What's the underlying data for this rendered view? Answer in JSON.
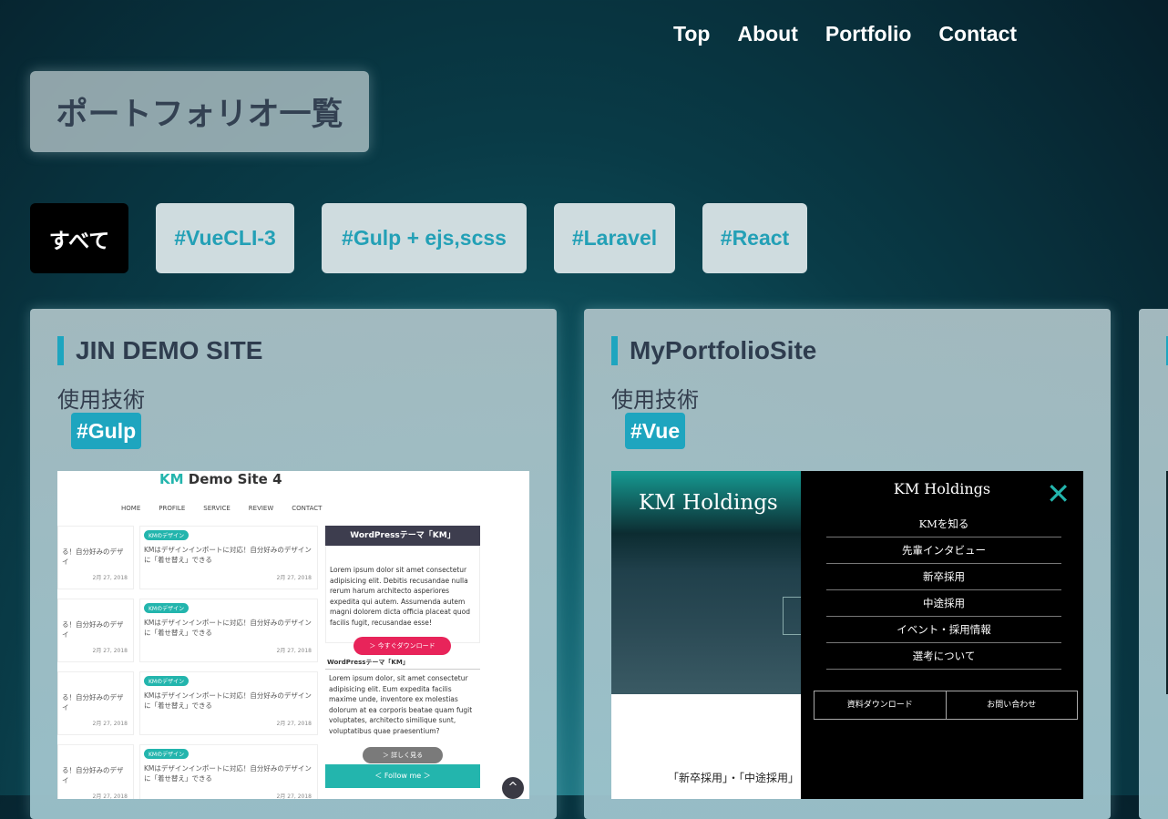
{
  "nav": [
    "Top",
    "About",
    "Portfolio",
    "Contact"
  ],
  "page_title": "ポートフォリオ一覧",
  "filters": [
    "すべて",
    "#VueCLI-3",
    "#Gulp + ejs,scss",
    "#Laravel",
    "#React"
  ],
  "tech_label": "使用技術",
  "cards": [
    {
      "title": "JIN DEMO SITE",
      "tag": "#Gulp",
      "preview": {
        "logo_accent": "KM",
        "logo_rest": " Demo Site 4",
        "menu": [
          "HOME",
          "PROFILE",
          "SERVICE",
          "REVIEW",
          "CONTACT"
        ],
        "post_badge": "KMのデザイン",
        "post_text": "KMはデザインインポートに対応！自分好みのデザインに「着せ替え」できる",
        "post_left_text": "る！自分好みのデザイ",
        "post_date": "2月 27, 2018",
        "side_head": "WordPressテーマ「KM」",
        "lorem1": "Lorem ipsum dolor sit amet consectetur adipisicing elit. Debitis recusandae nulla rerum harum architecto asperiores expedita qui autem. Assumenda autem magni dolorem dicta officia placeat quod facilis fugit, recusandae esse!",
        "download_btn": "＞ 今すぐダウンロード",
        "side_head2": "WordPressテーマ「KM」",
        "lorem2": "Lorem ipsum dolor, sit amet consectetur adipisicing elit. Eum expedita facilis maxime unde, inventore ex molestias dolorum at ea corporis beatae quam fugit voluptates, architecto similique sunt, voluptatibus quae praesentium?",
        "more_btn": "＞ 詳しく見る",
        "follow_btn": "＜ Follow me ＞",
        "totop": "^"
      }
    },
    {
      "title": "MyPortfolioSite",
      "tag": "#Vue",
      "preview": {
        "brand": "KM Holdings",
        "drawer_title": "KM Holdings",
        "close": "✕",
        "menu": [
          "KMを知る",
          "先輩インタビュー",
          "新卒採用",
          "中途採用",
          "イベント・採用情報",
          "選考について"
        ],
        "btn_left": "資料ダウンロード",
        "btn_right": "お問い合わせ",
        "recruit": "「新卒採用」・「中途採用」"
      }
    }
  ]
}
